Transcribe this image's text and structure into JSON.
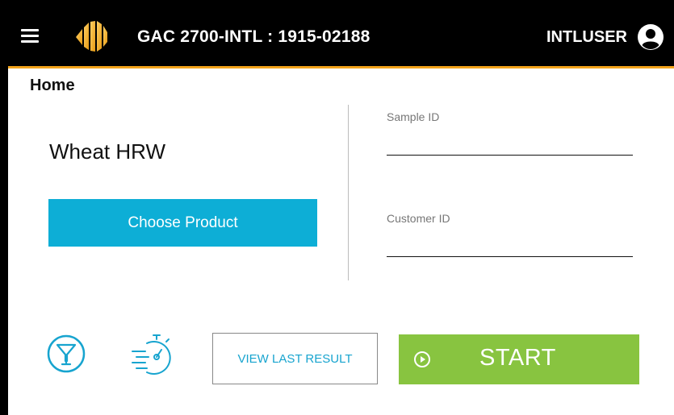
{
  "header": {
    "device_title": "GAC 2700-INTL : 1915-02188",
    "user_name": "INTLUSER"
  },
  "page": {
    "title": "Home"
  },
  "product": {
    "name": "Wheat HRW",
    "choose_label": "Choose Product"
  },
  "fields": {
    "sample_id": {
      "label": "Sample ID",
      "value": ""
    },
    "customer_id": {
      "label": "Customer ID",
      "value": ""
    }
  },
  "actions": {
    "filter_icon": "filter-icon",
    "timer_icon": "stopwatch-icon",
    "view_last_result": "VIEW LAST RESULT",
    "start": "START"
  },
  "colors": {
    "accent": "#f3a31b",
    "primary_button": "#0daed6",
    "start_button": "#88c440",
    "icon": "#17a4cf"
  }
}
